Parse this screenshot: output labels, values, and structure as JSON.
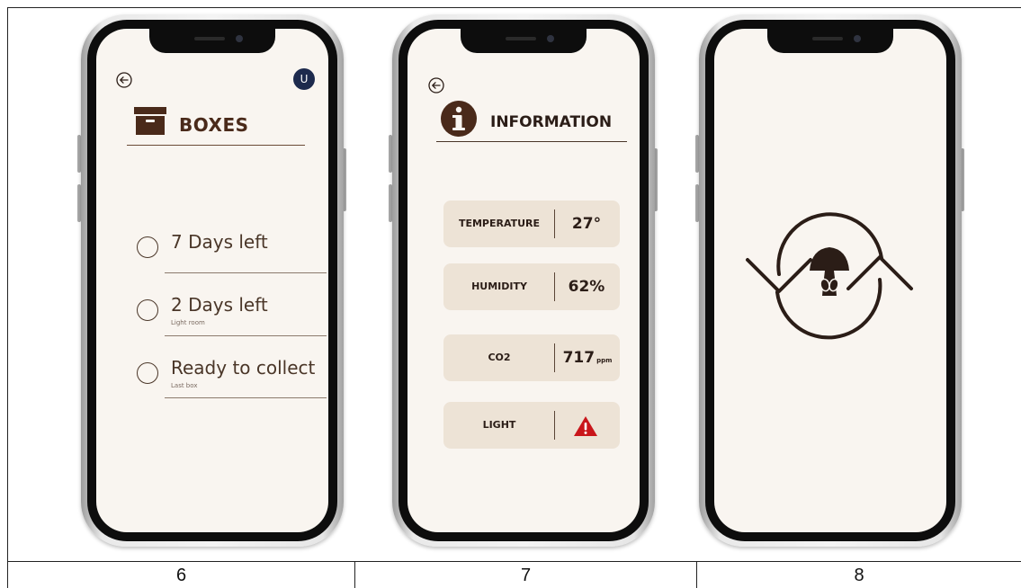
{
  "captions": [
    "6",
    "7",
    "8"
  ],
  "screen6": {
    "avatar_initial": "U",
    "title": "BOXES",
    "items": [
      {
        "label": "7 Days left",
        "sub": ""
      },
      {
        "label": "2 Days left",
        "sub": "Light room"
      },
      {
        "label": "Ready to collect",
        "sub": "Last box"
      }
    ]
  },
  "screen7": {
    "title": "INFORMATION",
    "rows": [
      {
        "key": "TEMPERATURE",
        "value": "27°",
        "unit": ""
      },
      {
        "key": "HUMIDITY",
        "value": "62%",
        "unit": ""
      },
      {
        "key": "CO2",
        "value": "717",
        "unit": "ppm"
      },
      {
        "key": "LIGHT",
        "value": "",
        "unit": "",
        "icon": "warning-icon"
      }
    ]
  },
  "screen8": {
    "icon": "mushroom-refresh-icon"
  },
  "colors": {
    "brown": "#4a2a1a",
    "dark_brown": "#2b1d17",
    "card": "#ede3d6",
    "screen": "#f9f5f0",
    "avatar": "#1d2a4d",
    "warning": "#c9161b"
  }
}
